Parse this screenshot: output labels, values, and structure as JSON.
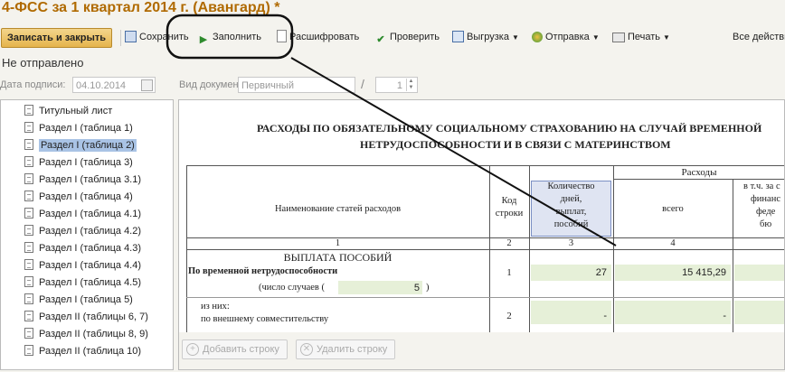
{
  "window": {
    "title": "4-ФСС за 1 квартал 2014 г. (Авангард) *"
  },
  "toolbar": {
    "save_close": "Записать и закрыть",
    "save": "Сохранить",
    "fill": "Заполнить",
    "decode": "Расшифровать",
    "check": "Проверить",
    "export": "Выгрузка",
    "send": "Отправка",
    "print": "Печать",
    "all_actions": "Все действия"
  },
  "status": {
    "text": "Не отправлено"
  },
  "form": {
    "date_label": "Дата подписи:",
    "date_value": "04.10.2014",
    "doc_type_label": "Вид документа:",
    "doc_type_value": "Первичный",
    "separator": "/",
    "correction_number": "1"
  },
  "sections": [
    {
      "label": "Титульный лист",
      "selected": false
    },
    {
      "label": "Раздел I (таблица 1)",
      "selected": false
    },
    {
      "label": "Раздел I (таблица 2)",
      "selected": true
    },
    {
      "label": "Раздел I (таблица 3)",
      "selected": false
    },
    {
      "label": "Раздел I (таблица 3.1)",
      "selected": false
    },
    {
      "label": "Раздел I (таблица 4)",
      "selected": false
    },
    {
      "label": "Раздел I (таблица 4.1)",
      "selected": false
    },
    {
      "label": "Раздел I (таблица 4.2)",
      "selected": false
    },
    {
      "label": "Раздел I (таблица 4.3)",
      "selected": false
    },
    {
      "label": "Раздел I (таблица 4.4)",
      "selected": false
    },
    {
      "label": "Раздел I (таблица 4.5)",
      "selected": false
    },
    {
      "label": "Раздел I (таблица 5)",
      "selected": false
    },
    {
      "label": "Раздел II (таблицы 6, 7)",
      "selected": false
    },
    {
      "label": "Раздел II (таблицы 8, 9)",
      "selected": false
    },
    {
      "label": "Раздел II (таблица 10)",
      "selected": false
    }
  ],
  "report": {
    "title_line1": "РАСХОДЫ ПО ОБЯЗАТЕЛЬНОМУ СОЦИАЛЬНОМУ СТРАХОВАНИЮ НА СЛУЧАЙ ВРЕМЕННОЙ",
    "title_line2": "НЕТРУДОСПОСОБНОСТИ И В СВЯЗИ С МАТЕРИНСТВОМ",
    "col_name_header": "Наименование статей расходов",
    "col_code_header_1": "Код",
    "col_code_header_2": "строки",
    "col_days_header_1": "Количество",
    "col_days_header_2": "дней,",
    "col_days_header_3": "выплат,",
    "col_days_header_4": "пособий",
    "expenses_header": "Расходы",
    "col_total_header": "всего",
    "col_fed_header_1": "в т.ч. за с",
    "col_fed_header_2": "финанс",
    "col_fed_header_3": "феде",
    "col_fed_header_4": "бю",
    "num_1": "1",
    "num_2": "2",
    "num_3": "3",
    "num_4": "4",
    "benefits_header": "ВЫПЛАТА ПОСОБИЙ",
    "row1_label": "По временной нетрудоспособности",
    "row1_code": "1",
    "row1_days": "27",
    "row1_total": "15 415,29",
    "cases_label": "(число случаев (",
    "cases_value": "5",
    "cases_close": ")",
    "of_them": "из них:",
    "row2_label": "по внешнему совместительству",
    "row2_code": "2",
    "row2_days": "-",
    "row2_total": "-"
  },
  "bottom_actions": {
    "add_row": "Добавить строку",
    "delete_row": "Удалить строку"
  },
  "colors": {
    "title": "#b06a00",
    "selection": "#a9c3e5",
    "editable_cell": "#e6f0d8",
    "highlight_header": "#dfe4f2"
  }
}
